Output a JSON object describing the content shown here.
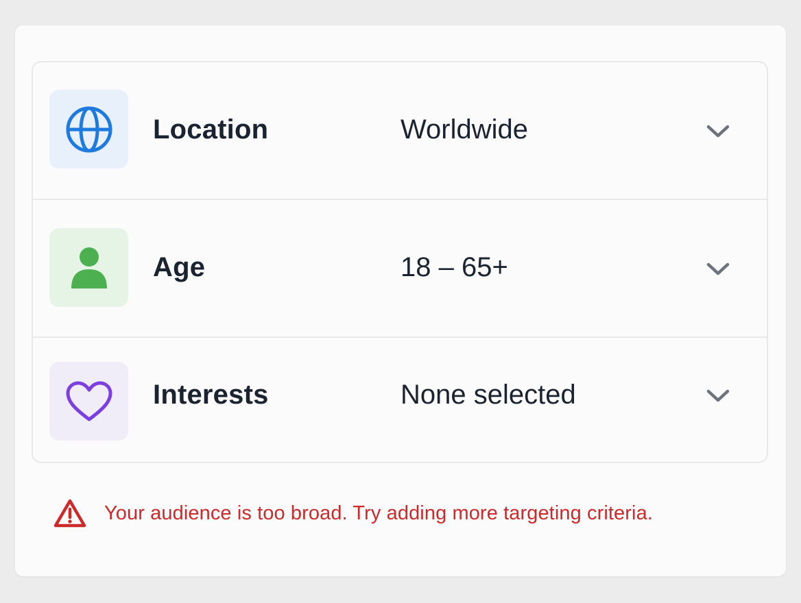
{
  "targeting": {
    "rows": [
      {
        "icon": "globe-icon",
        "label": "Location",
        "value": "Worldwide"
      },
      {
        "icon": "person-icon",
        "label": "Age",
        "value": "18 – 65+"
      },
      {
        "icon": "heart-icon",
        "label": "Interests",
        "value": "None selected"
      }
    ]
  },
  "warning": {
    "icon": "warning-icon",
    "text": "Your audience is too broad. Try adding more targeting criteria.",
    "color": "#cc2a2a"
  },
  "colors": {
    "globe": "#1f7ae0",
    "person": "#4caf50",
    "heart": "#7c3fe0"
  }
}
